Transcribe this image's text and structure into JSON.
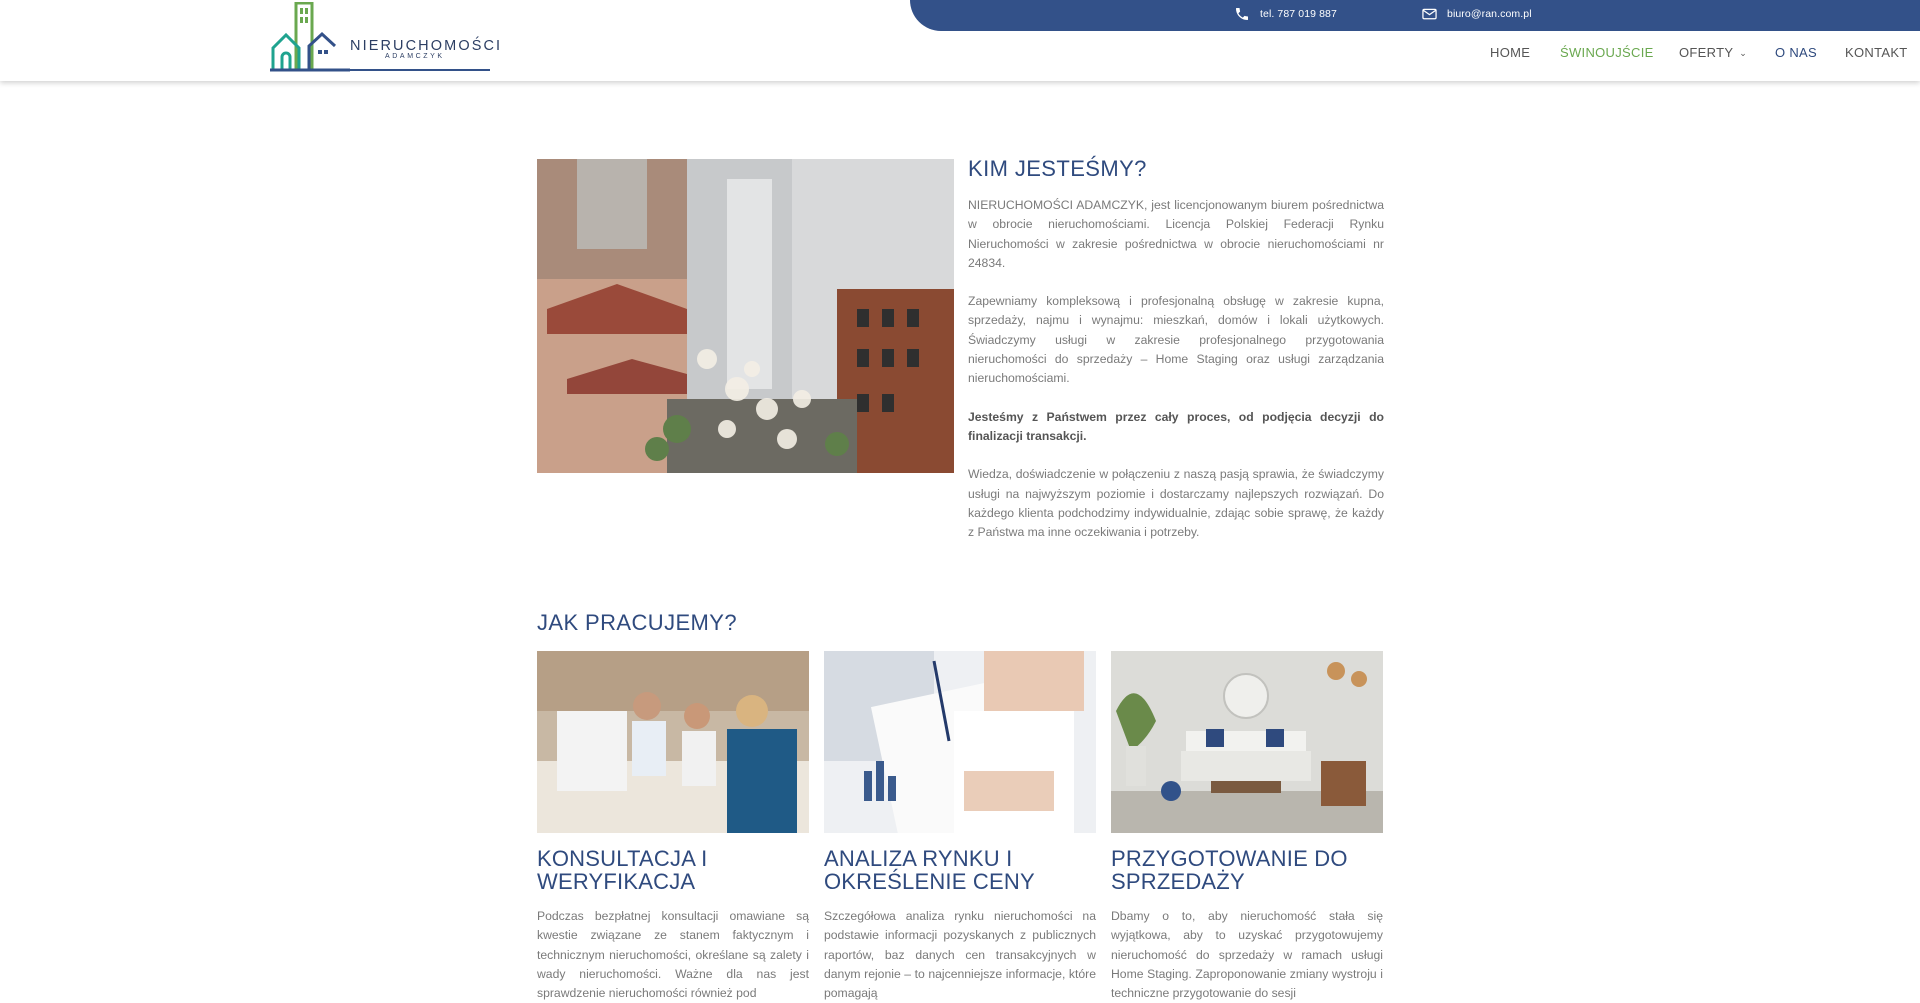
{
  "header": {
    "phone": "tel. 787 019 887",
    "email": "biuro@ran.com.pl",
    "logo": {
      "name": "NIERUCHOMOŚCI",
      "sub": "ADAMCZYK"
    },
    "nav": [
      {
        "label": "HOME"
      },
      {
        "label": "ŚWINOUJŚCIE"
      },
      {
        "label": "OFERTY"
      },
      {
        "label": "O NAS"
      },
      {
        "label": "KONTAKT"
      }
    ]
  },
  "about": {
    "title": "KIM JESTEŚMY?",
    "paragraphs": [
      "NIERUCHOMOŚCI ADAMCZYK, jest licencjonowanym biurem pośrednictwa w obrocie nieruchomościami. Licencja Polskiej Federacji Rynku Nieruchomości w zakresie pośrednictwa w obrocie nieruchomościami nr 24834.",
      "Zapewniamy kompleksową i profesjonalną obsługę w zakresie kupna, sprzedaży, najmu i wynajmu: mieszkań, domów i lokali użytkowych. Świadczymy usługi w zakresie profesjonalnego przygotowania nieruchomości do sprzedaży – Home Staging oraz usługi zarządzania nieruchomościami.",
      "Jesteśmy z Państwem przez cały proces, od podjęcia decyzji do finalizacji transakcji.",
      "Wiedza, doświadczenie w połączeniu z naszą pasją sprawia, że świadczymy usługi na najwyższym poziomie i dostarczamy najlepszych rozwiązań. Do każdego klienta podchodzimy indywidualnie, zdając sobie sprawę, że każdy z Państwa ma inne oczekiwania i potrzeby."
    ]
  },
  "work": {
    "title": "JAK PRACUJEMY?",
    "cards": [
      {
        "title": "KONSULTACJA I WERYFIKACJA",
        "text": "Podczas bezpłatnej konsultacji omawiane są kwestie związane ze stanem faktycznym i technicznym nieruchomości, określane są zalety i wady nieruchomości. Ważne dla nas jest sprawdzenie nieruchomości również pod"
      },
      {
        "title": "ANALIZA RYNKU I OKREŚLENIE CENY",
        "text": "Szczegółowa analiza rynku nieruchomości na podstawie informacji pozyskanych z publicznych raportów, baz danych cen transakcyjnych w danym rejonie – to najcenniejsze informacje, które pomagają"
      },
      {
        "title": "PRZYGOTOWANIE DO SPRZEDAŻY",
        "text": "Dbamy o to, aby nieruchomość stała się wyjątkowa, aby to uzyskać przygotowujemy nieruchomość do sprzedaży w ramach usługi Home Staging. Zaproponowanie zmiany wystroju i techniczne przygotowanie do sesji"
      }
    ]
  },
  "colors": {
    "brand": "#335189",
    "accent": "#6aa84f",
    "heading": "#2f4a7e"
  }
}
